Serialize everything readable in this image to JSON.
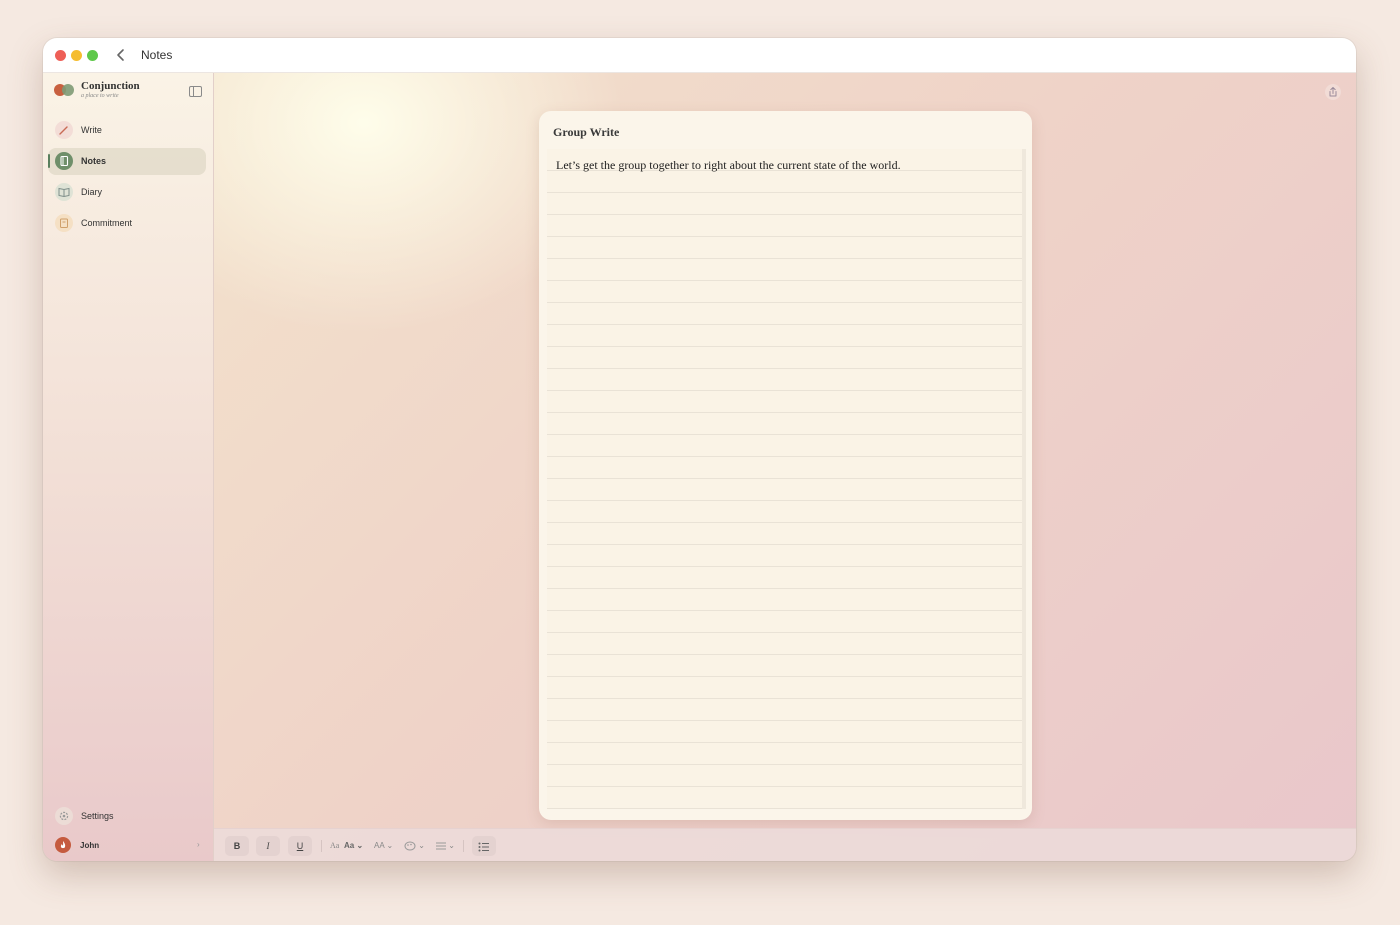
{
  "window": {
    "title": "Notes"
  },
  "sidebar": {
    "brand": {
      "name": "Conjunction",
      "tagline": "a place to write"
    },
    "items": [
      {
        "label": "Write",
        "icon": "pencil-icon",
        "color": "#f3ddd7"
      },
      {
        "label": "Notes",
        "icon": "notebook-icon",
        "color": "#6f8f6a",
        "active": true
      },
      {
        "label": "Diary",
        "icon": "book-open-icon",
        "color": "#dfe3d6"
      },
      {
        "label": "Commitment",
        "icon": "clipboard-icon",
        "color": "#f5e0c4"
      }
    ],
    "settings_label": "Settings",
    "user": {
      "name": "John",
      "avatar_color": "#c55b3f"
    }
  },
  "note": {
    "title": "Group Write",
    "body": "Let’s get the group together to right about the current state of the world."
  },
  "toolbar": {
    "bold_label": "B",
    "italic_label": "I",
    "underline_label": "U",
    "font_family_label": "Aa",
    "font_style_label": "Aa",
    "font_size_label": "AA"
  },
  "colors": {
    "accent": "#5a7f5e",
    "traffic_red": "#ee5f57",
    "traffic_yellow": "#f5bd2f",
    "traffic_green": "#5ec84a"
  }
}
